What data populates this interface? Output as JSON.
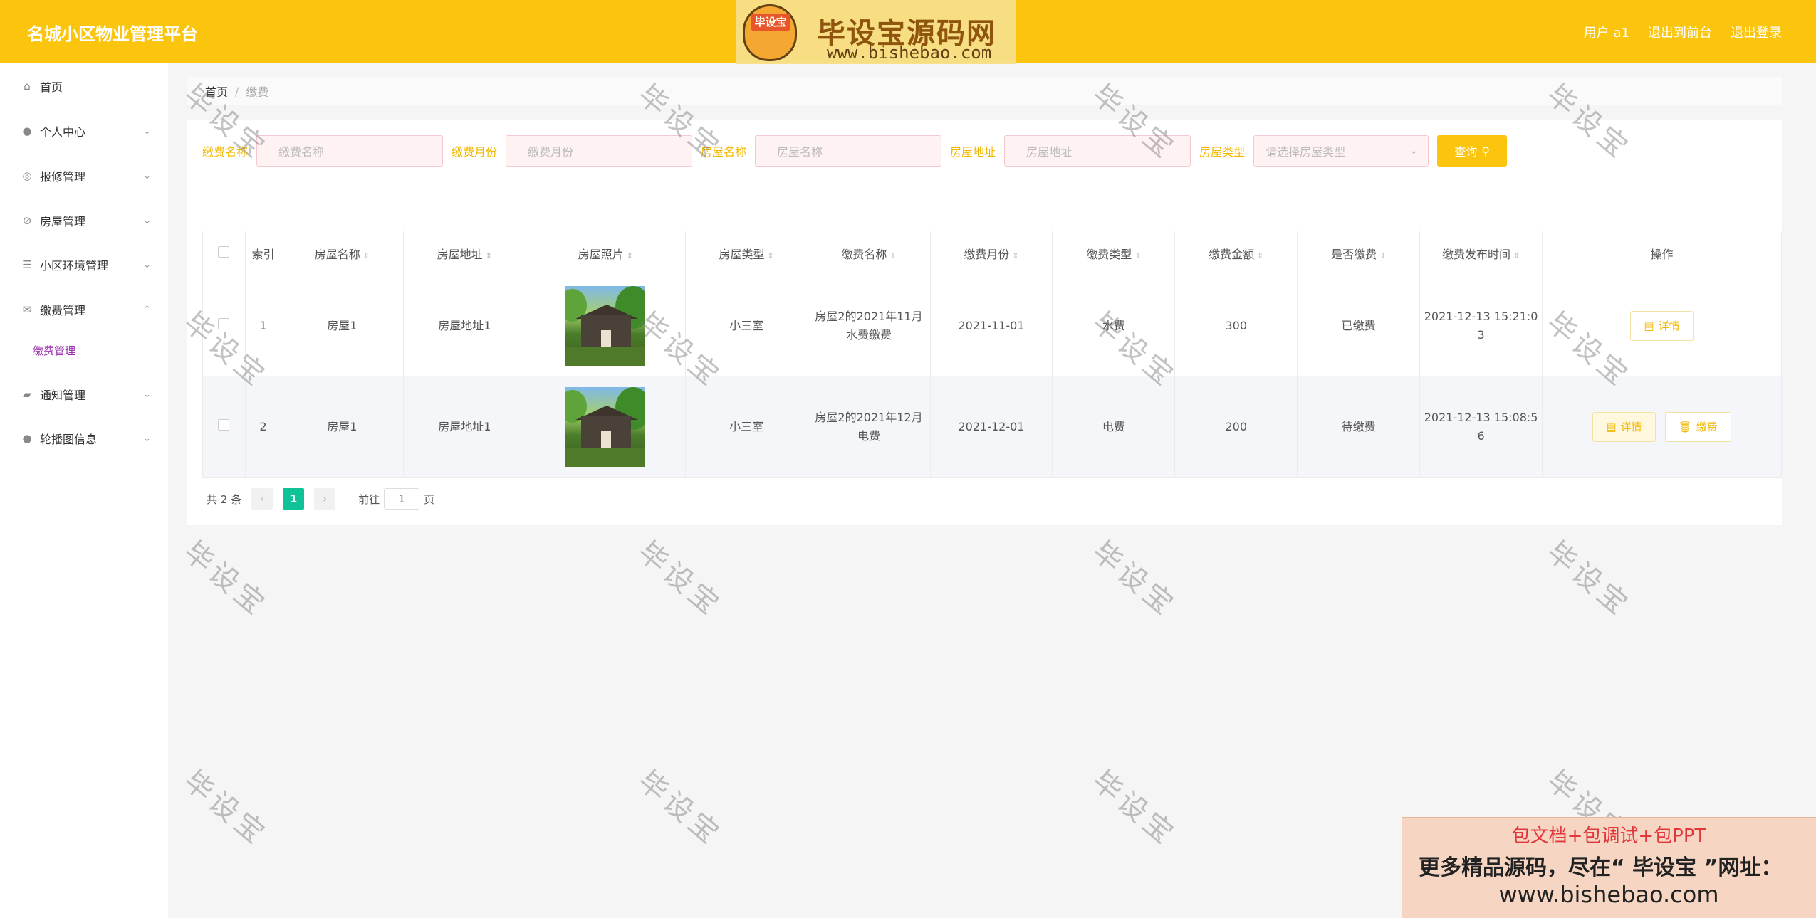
{
  "header": {
    "app_title": "名城小区物业管理平台",
    "user_label": "用户 a1",
    "front_label": "退出到前台",
    "logout_label": "退出登录"
  },
  "watermark_logo": {
    "badge": "毕设宝",
    "title": "毕设宝源码网",
    "url": "www.bishebao.com"
  },
  "sidebar": {
    "items": [
      {
        "label": "首页",
        "icon": "home-icon"
      },
      {
        "label": "个人中心",
        "icon": "user-icon"
      },
      {
        "label": "报修管理",
        "icon": "repair-icon"
      },
      {
        "label": "房屋管理",
        "icon": "house-icon"
      },
      {
        "label": "小区环境管理",
        "icon": "sliders-icon"
      },
      {
        "label": "缴费管理",
        "icon": "mail-icon"
      },
      {
        "label": "通知管理",
        "icon": "notice-icon"
      },
      {
        "label": "轮播图信息",
        "icon": "image-icon"
      }
    ],
    "sub_item": "缴费管理"
  },
  "breadcrumb": {
    "home": "首页",
    "separator": "/",
    "current": "缴费"
  },
  "search": {
    "fields": [
      {
        "label": "缴费名称",
        "placeholder": "缴费名称"
      },
      {
        "label": "缴费月份",
        "placeholder": "缴费月份"
      },
      {
        "label": "房屋名称",
        "placeholder": "房屋名称"
      },
      {
        "label": "房屋地址",
        "placeholder": "房屋地址"
      },
      {
        "label": "房屋类型",
        "placeholder": "请选择房屋类型"
      }
    ],
    "button_label": "查询"
  },
  "table": {
    "headers": [
      "索引",
      "房屋名称",
      "房屋地址",
      "房屋照片",
      "房屋类型",
      "缴费名称",
      "缴费月份",
      "缴费类型",
      "缴费金额",
      "是否缴费",
      "缴费发布时间",
      "操作"
    ],
    "rows": [
      {
        "index": "1",
        "house_name": "房屋1",
        "house_address": "房屋地址1",
        "house_type": "小三室",
        "fee_name_l1": "房屋2的2021年11月",
        "fee_name_l2": "水费缴费",
        "fee_month": "2021-11-01",
        "fee_type": "水费",
        "amount": "300",
        "paid": "已缴费",
        "time_l1": "2021-12-13 15:21:0",
        "time_l2": "3",
        "detail_label": "详情"
      },
      {
        "index": "2",
        "house_name": "房屋1",
        "house_address": "房屋地址1",
        "house_type": "小三室",
        "fee_name_l1": "房屋2的2021年12月",
        "fee_name_l2": "电费",
        "fee_month": "2021-12-01",
        "fee_type": "电费",
        "amount": "200",
        "paid": "待缴费",
        "time_l1": "2021-12-13 15:08:5",
        "time_l2": "6",
        "detail_label": "详情",
        "pay_label": "缴费"
      }
    ]
  },
  "pager": {
    "total": "共 2 条",
    "current": "1",
    "goto_prefix": "前往",
    "goto_value": "1",
    "goto_suffix": "页"
  },
  "watermark_text": "毕设宝",
  "ad": {
    "line1": "包文档+包调试+包PPT",
    "line2": "更多精品源码，尽在“ 毕设宝 ”网址：",
    "line3": "www.bishebao.com"
  }
}
